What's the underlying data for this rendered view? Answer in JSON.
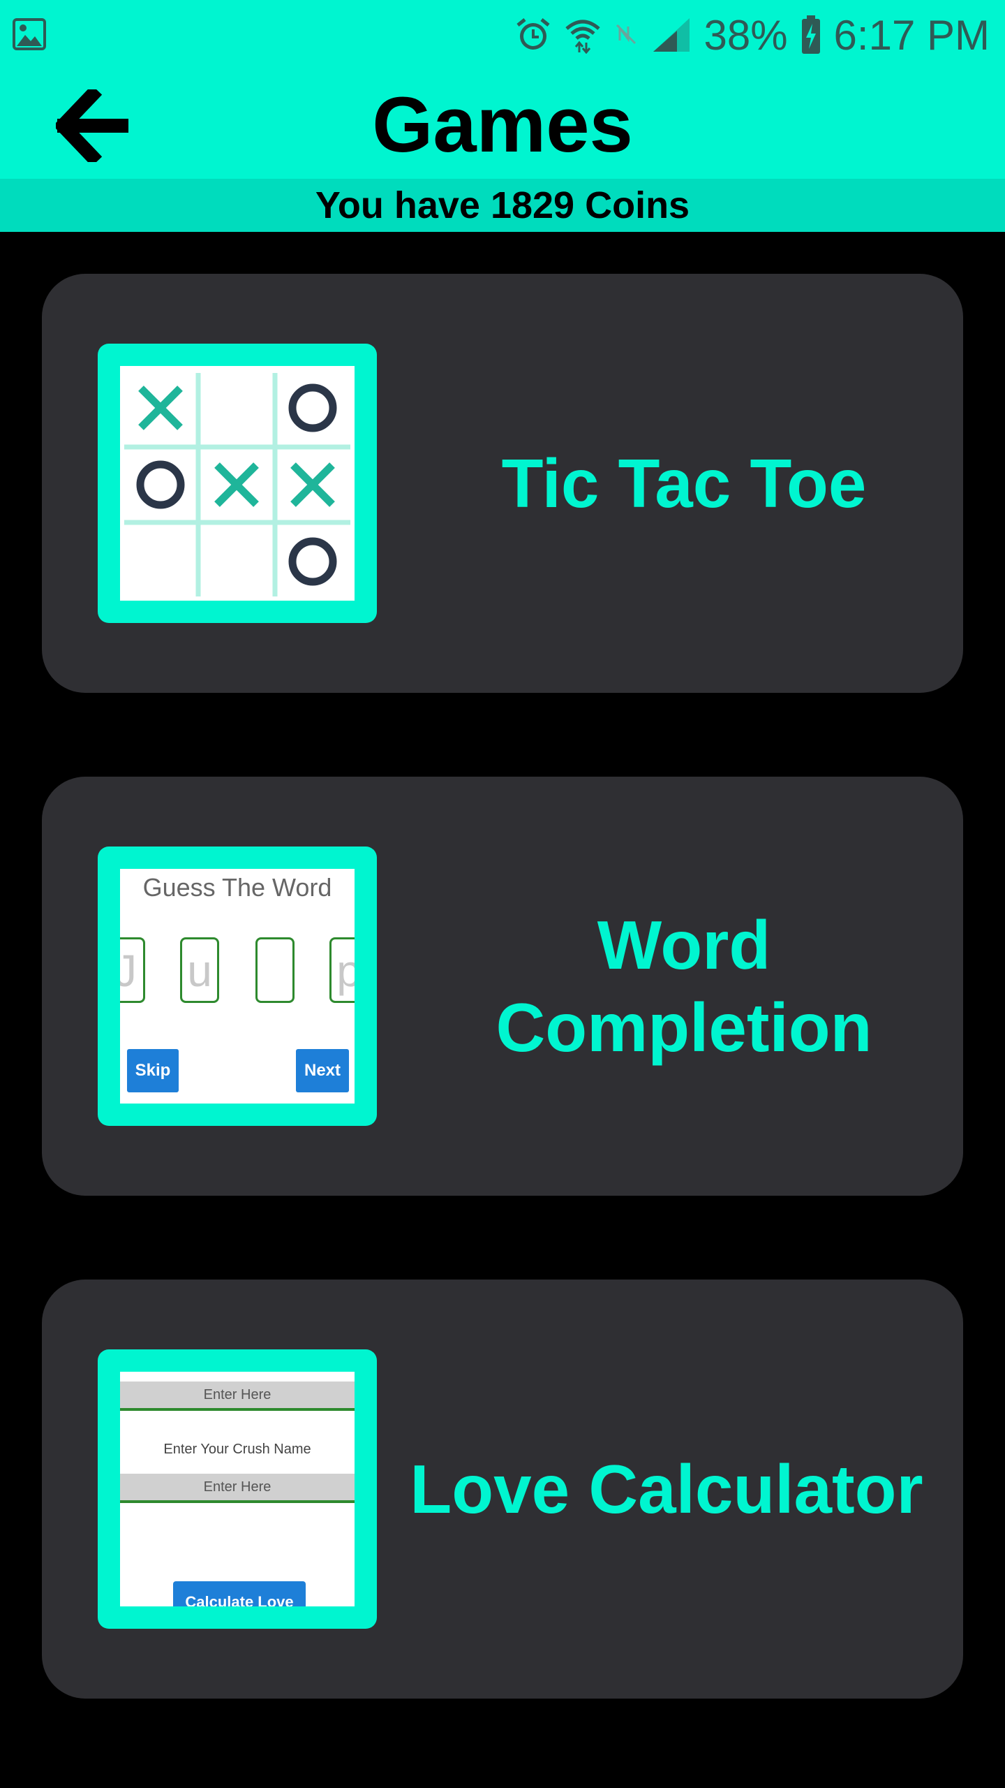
{
  "status_bar": {
    "battery": "38%",
    "time": "6:17 PM",
    "icons": [
      "gallery-icon",
      "alarm-icon",
      "wifi-icon",
      "nfc-icon",
      "signal-icon",
      "battery-charging-icon"
    ]
  },
  "header": {
    "title": "Games",
    "back_icon": "arrow-left-icon",
    "coins_text": "You have 1829 Coins"
  },
  "games": [
    {
      "label": "Tic Tac Toe",
      "thumbnail": {
        "board": [
          "X",
          "",
          "O",
          "O",
          "X",
          "X",
          "",
          "",
          "O"
        ]
      }
    },
    {
      "label_line1": "Word",
      "label_line2": "Completion",
      "thumbnail": {
        "title": "Guess The Word",
        "letters": [
          "J",
          "u",
          "",
          "p"
        ],
        "skip": "Skip",
        "next": "Next"
      }
    },
    {
      "label": "Love Calculator",
      "thumbnail": {
        "field1_placeholder": "Enter Here",
        "crush_label": "Enter Your Crush Name",
        "field2_placeholder": "Enter Here",
        "button": "Calculate Love"
      }
    }
  ],
  "colors": {
    "accent": "#00f5d0",
    "card_bg": "#2f2f33",
    "background": "#000000",
    "x_color": "#1fb59a",
    "o_color": "#2b3648"
  }
}
